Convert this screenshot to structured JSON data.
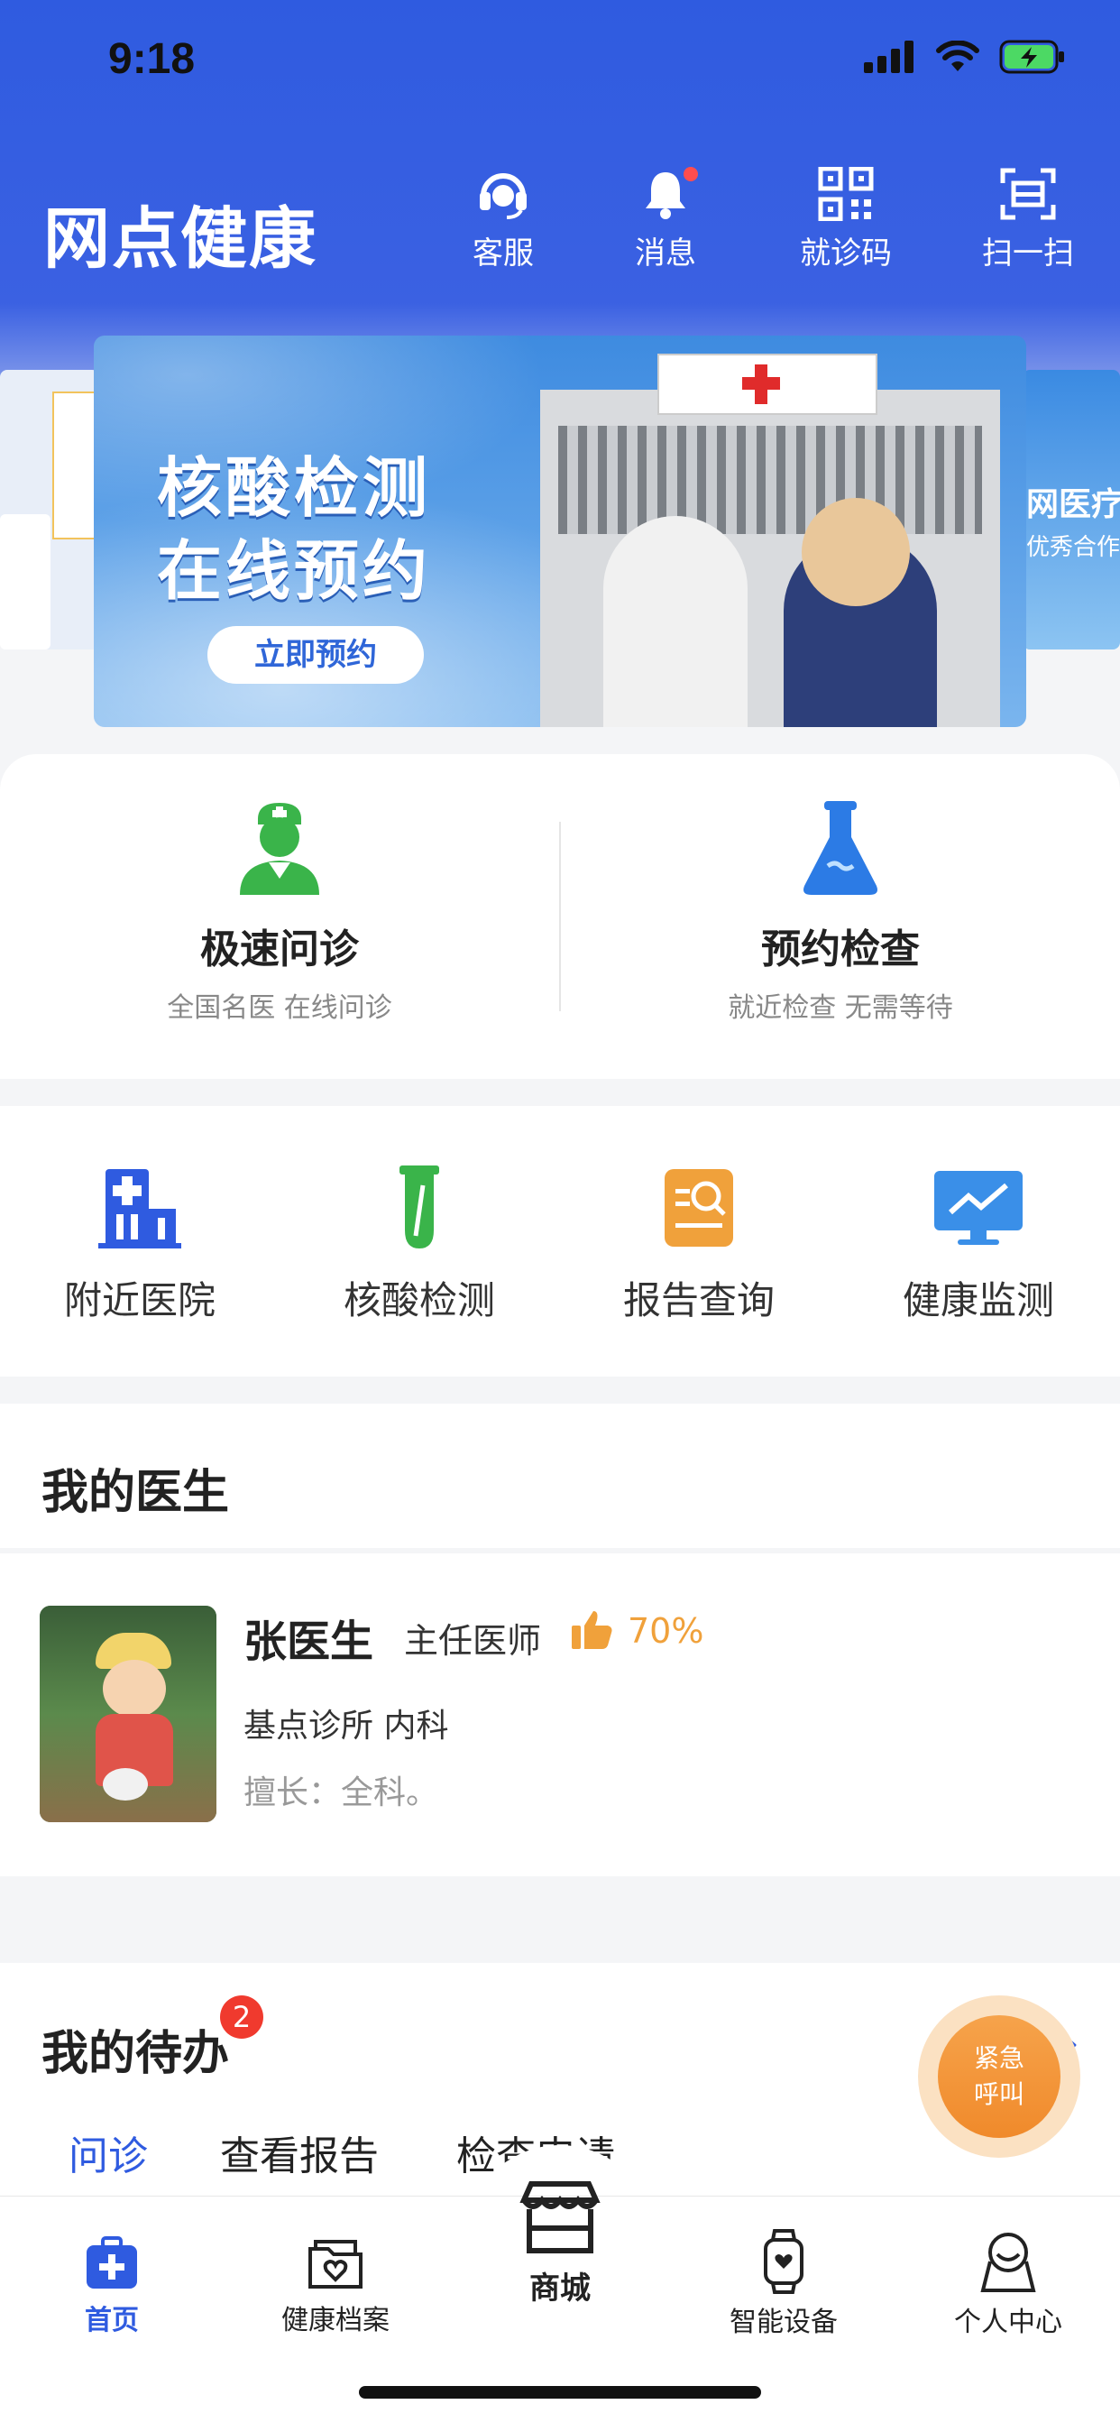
{
  "status": {
    "time": "9:18"
  },
  "header": {
    "app_title": "网点健康",
    "actions": [
      {
        "label": "客服",
        "icon": "headset-icon"
      },
      {
        "label": "消息",
        "icon": "bell-icon"
      },
      {
        "label": "就诊码",
        "icon": "qr-code-icon"
      },
      {
        "label": "扫一扫",
        "icon": "scan-icon"
      }
    ]
  },
  "banner": {
    "line1": "核酸检测",
    "line2": "在线预约",
    "button": "立即预约",
    "side_right_text": "网医疗服\n优秀合作伙伴"
  },
  "features": [
    {
      "title": "极速问诊",
      "subtitle": "全国名医 在线问诊",
      "icon": "doctor-icon"
    },
    {
      "title": "预约检查",
      "subtitle": "就近检查 无需等待",
      "icon": "flask-icon"
    }
  ],
  "quick": [
    {
      "label": "附近医院",
      "icon": "hospital-icon"
    },
    {
      "label": "核酸检测",
      "icon": "test-tube-icon"
    },
    {
      "label": "报告查询",
      "icon": "report-search-icon"
    },
    {
      "label": "健康监测",
      "icon": "monitor-icon"
    }
  ],
  "doctor_section": {
    "title": "我的医生",
    "name": "张医生",
    "title_rank": "主任医师",
    "rating": "70%",
    "clinic": "基点诊所 内科",
    "specialty": "擅长：全科。"
  },
  "todo": {
    "title": "我的待办",
    "badge": "2",
    "tabs": [
      "问诊",
      "查看报告",
      "检查申请"
    ]
  },
  "emergency": {
    "line1": "紧急",
    "line2": "呼叫"
  },
  "tabbar": [
    {
      "label": "首页",
      "icon": "home-medkit-icon",
      "active": true
    },
    {
      "label": "健康档案",
      "icon": "folder-heart-icon"
    },
    {
      "label": "商城",
      "icon": "store-icon"
    },
    {
      "label": "智能设备",
      "icon": "smartwatch-icon"
    },
    {
      "label": "个人中心",
      "icon": "person-icon"
    }
  ],
  "colors": {
    "primary": "#2f5be0",
    "accent": "#f0a13b",
    "badge": "#f03a2e"
  }
}
